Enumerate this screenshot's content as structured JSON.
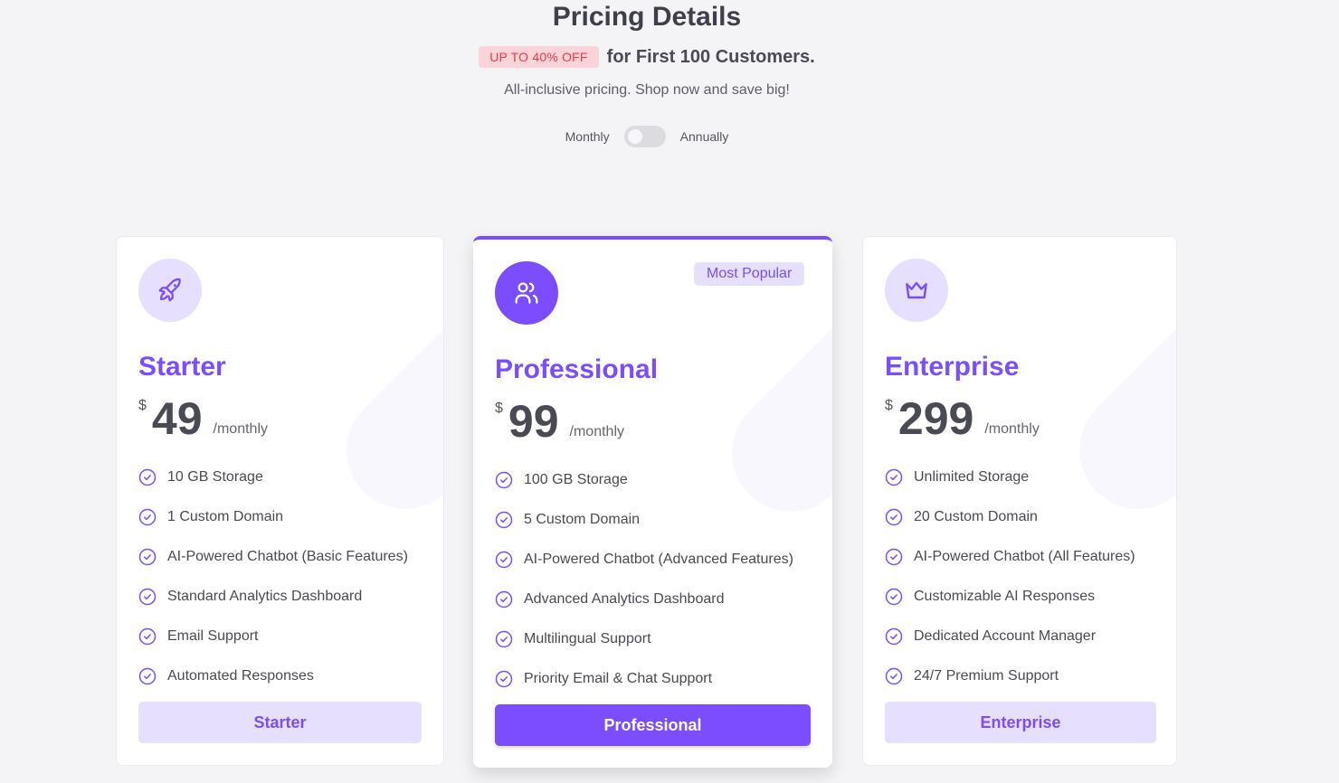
{
  "header": {
    "title": "Pricing Details",
    "promo_badge": "UP TO 40% OFF",
    "promo_text": "for First 100 Customers.",
    "subtitle": "All-inclusive pricing. Shop now and save big!",
    "billing": {
      "monthly_label": "Monthly",
      "annually_label": "Annually",
      "annual_selected": false
    }
  },
  "colors": {
    "accent": "#7b4dff",
    "accent_light": "#e6dffe",
    "promo_bg": "#fad4d8",
    "promo_text": "#ef3a4a",
    "background": "#f4f4f6"
  },
  "plans": [
    {
      "name": "Starter",
      "icon": "rocket-icon",
      "currency": "$",
      "price": "49",
      "period": "/monthly",
      "featured": false,
      "features": [
        "10 GB Storage",
        "1 Custom Domain",
        "AI-Powered Chatbot (Basic Features)",
        "Standard Analytics Dashboard",
        "Email Support",
        "Automated Responses"
      ],
      "button_label": "Starter"
    },
    {
      "name": "Professional",
      "icon": "users-icon",
      "currency": "$",
      "price": "99",
      "period": "/monthly",
      "featured": true,
      "badge": "Most Popular",
      "features": [
        "100 GB Storage",
        "5 Custom Domain",
        "AI-Powered Chatbot (Advanced Features)",
        "Advanced Analytics Dashboard",
        "Multilingual Support",
        "Priority Email & Chat Support"
      ],
      "button_label": "Professional"
    },
    {
      "name": "Enterprise",
      "icon": "crown-icon",
      "currency": "$",
      "price": "299",
      "period": "/monthly",
      "featured": false,
      "features": [
        "Unlimited Storage",
        "20 Custom Domain",
        "AI-Powered Chatbot (All Features)",
        "Customizable AI Responses",
        "Dedicated Account Manager",
        "24/7 Premium Support"
      ],
      "button_label": "Enterprise"
    }
  ]
}
